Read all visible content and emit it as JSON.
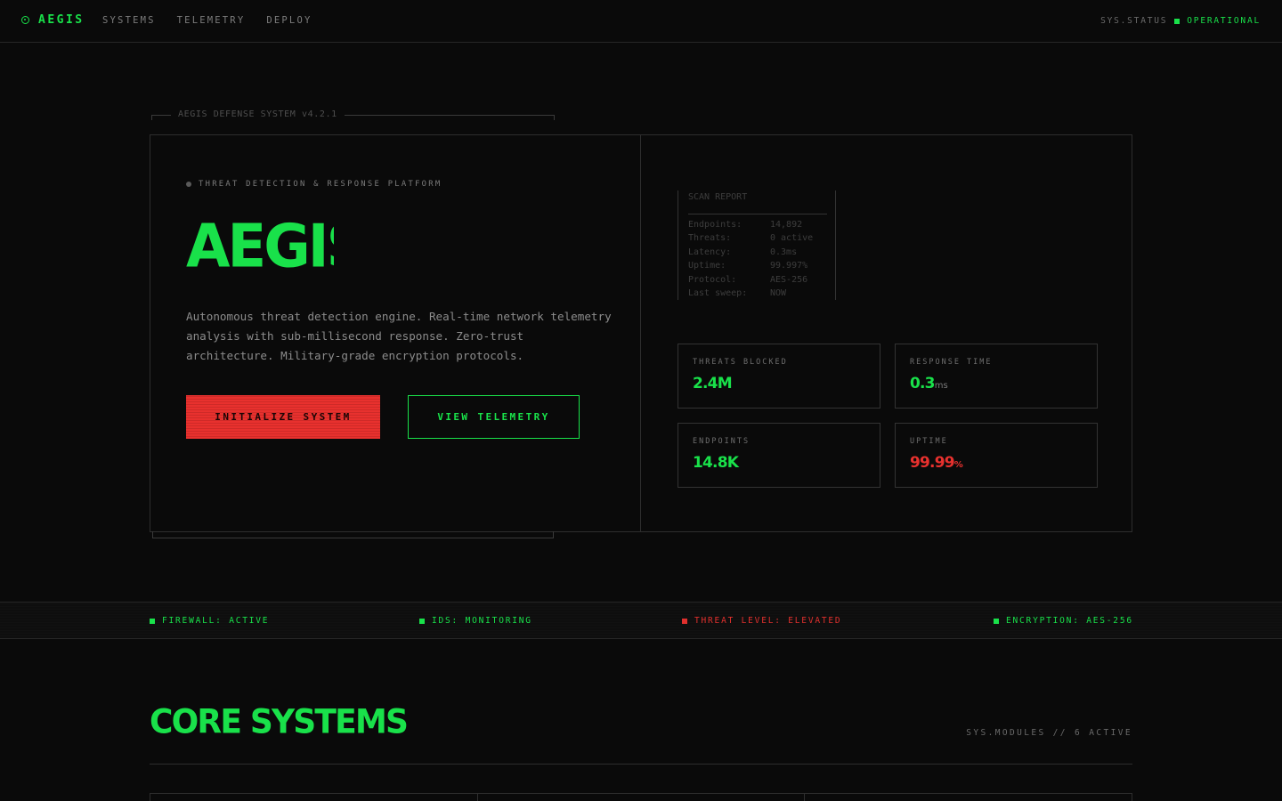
{
  "nav": {
    "brand": "AEGIS",
    "links": [
      "SYSTEMS",
      "TELEMETRY",
      "DEPLOY"
    ],
    "status_label": "SYS.STATUS",
    "status_value": "OPERATIONAL"
  },
  "hero": {
    "tag": "AEGIS DEFENSE SYSTEM v4.2.1",
    "eyebrow": "THREAT DETECTION & RESPONSE PLATFORM",
    "title": "AEGIS",
    "description": "Autonomous threat detection engine. Real-time network telemetry analysis with sub-millisecond response. Zero-trust architecture. Military-grade encryption protocols.",
    "primary_button": "INITIALIZE SYSTEM",
    "secondary_button": "VIEW TELEMETRY"
  },
  "report": {
    "title": "SCAN REPORT",
    "rows": [
      {
        "key": "Endpoints:",
        "value": "14,892"
      },
      {
        "key": "Threats:",
        "value": "0 active"
      },
      {
        "key": "Latency:",
        "value": "0.3ms"
      },
      {
        "key": "Uptime:",
        "value": "99.997%"
      },
      {
        "key": "Protocol:",
        "value": "AES-256"
      },
      {
        "key": "Last sweep:",
        "value": "NOW"
      }
    ]
  },
  "metrics": [
    {
      "label": "THREATS BLOCKED",
      "value": "2.4M",
      "unit": ""
    },
    {
      "label": "RESPONSE TIME",
      "value": "0.3",
      "unit": "ms"
    },
    {
      "label": "ENDPOINTS",
      "value": "14.8K",
      "unit": ""
    },
    {
      "label": "UPTIME",
      "value": "99.99",
      "unit": "%"
    }
  ],
  "ticker": [
    {
      "text": "FIREWALL: ACTIVE",
      "status_color": "#19e14a"
    },
    {
      "text": "IDS: MONITORING",
      "status_color": "#19e14a"
    },
    {
      "text": "THREAT LEVEL: ELEVATED",
      "status_color": "#e0302d"
    },
    {
      "text": "ENCRYPTION: AES-256",
      "status_color": "#19e14a"
    }
  ],
  "core": {
    "title": "CORE SYSTEMS",
    "meta": "SYS.MODULES // 6 ACTIVE"
  },
  "colors": {
    "accent": "#19e14a",
    "alert": "#e8312e",
    "background": "#0a0a0a"
  }
}
